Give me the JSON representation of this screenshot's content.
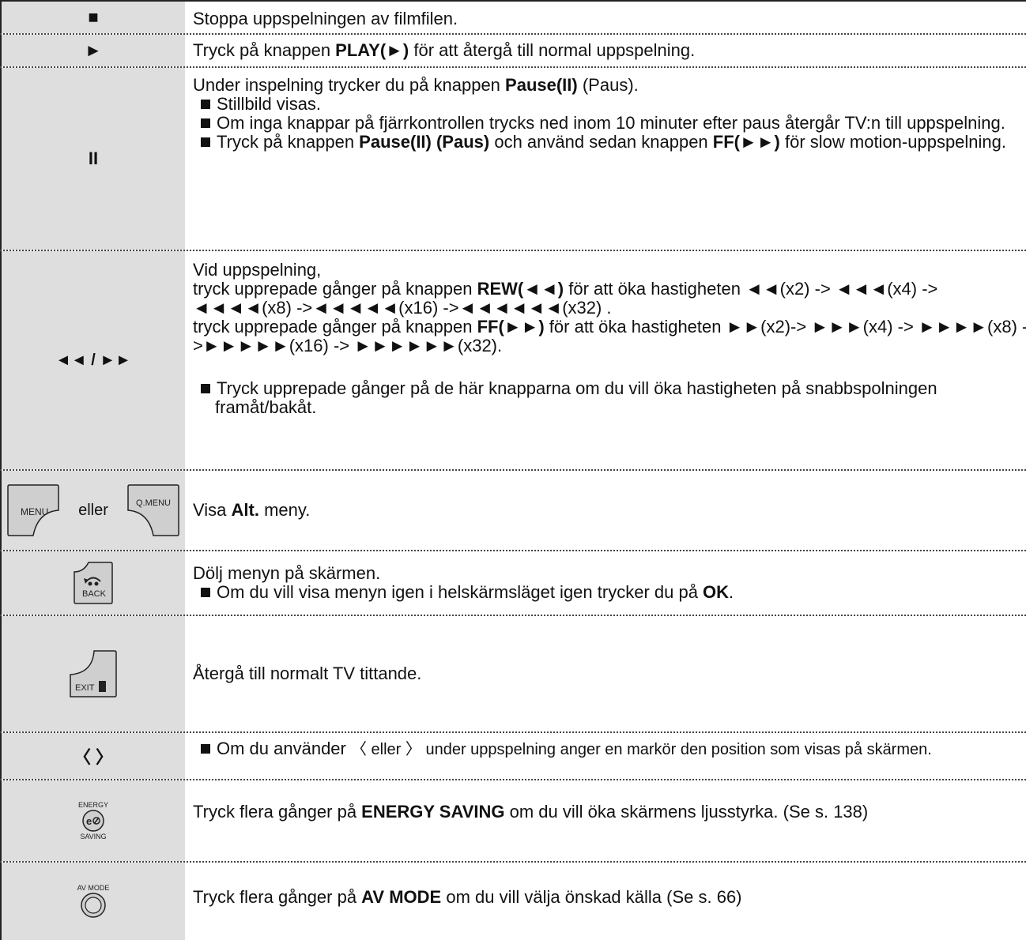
{
  "rows": [
    {
      "key": "■",
      "lines": [
        {
          "text": "Stoppa uppspelningen av filmfilen."
        }
      ]
    },
    {
      "key": "►",
      "lines": [
        {
          "pre": "Tryck på knappen ",
          "b": "PLAY(►)",
          "post": " för att återgå till normal uppspelning."
        }
      ]
    },
    {
      "key": "II",
      "intro": {
        "pre": "Under inspelning trycker du på knappen ",
        "b": "Pause(II)",
        "post": " (Paus)."
      },
      "bullets": [
        "Stillbild visas.",
        "Om inga knappar på fjärrkontrollen trycks ned inom 10 minuter efter paus återgår TV:n till uppspelning."
      ],
      "bullet3": {
        "pre": "Tryck på knappen ",
        "b": "Pause(II) (Paus)",
        "mid": " och använd sedan knappen ",
        "b2": "FF(►►)",
        "post": " för slow motion-uppspelning."
      }
    },
    {
      "key": "◄◄ / ►►",
      "l1": "Vid uppspelning,",
      "l2": {
        "pre": "tryck upprepade gånger på knappen ",
        "b": "REW(◄◄)",
        "post": " för att öka hastigheten ◄◄(x2) -> ◄◄◄(x4) -> ◄◄◄◄(x8) ->◄◄◄◄◄(x16) ->◄◄◄◄◄◄(x32) ."
      },
      "l3": {
        "pre": "tryck upprepade gånger på knappen ",
        "b": "FF(►►)",
        "post": " för att öka hastigheten ►►(x2)-> ►►►(x4) -> ►►►►(x8) ->►►►►►(x16) -> ►►►►►►(x32)."
      },
      "bullet": "Tryck upprepade gånger på de här knapparna om du vill öka hastigheten på snabbspolningen framåt/bakåt."
    },
    {
      "key_menu": "MENU",
      "key_or": "eller",
      "key_qmenu": "Q.MENU",
      "pre": "Visa ",
      "b": "Alt.",
      "post": " meny."
    },
    {
      "key_back": "BACK",
      "l1": "Dölj menyn på skärmen.",
      "bullet": {
        "pre": "Om du vill visa menyn igen i helskärmsläget igen trycker du på ",
        "b": "OK",
        "post": "."
      }
    },
    {
      "key_exit": "EXIT",
      "text": "Återgå till normalt TV tittande."
    },
    {
      "key": "〈 〉",
      "bullet": {
        "pre": "Om du använder ",
        "lt": "〈",
        "mid": " eller ",
        "gt": "〉",
        "post": " under uppspelning anger en markör den position som visas på skärmen."
      }
    },
    {
      "key_top": "ENERGY",
      "key_bottom": "SAVING",
      "pre": "Tryck flera gånger på ",
      "b": "ENERGY SAVING",
      "post": " om du vill öka skärmens ljusstyrka. (Se s. 138)"
    },
    {
      "key_top": "AV MODE",
      "pre": "Tryck flera gånger på ",
      "b": "AV MODE",
      "post": " om du vill välja önskad källa (Se s. 66)"
    }
  ]
}
